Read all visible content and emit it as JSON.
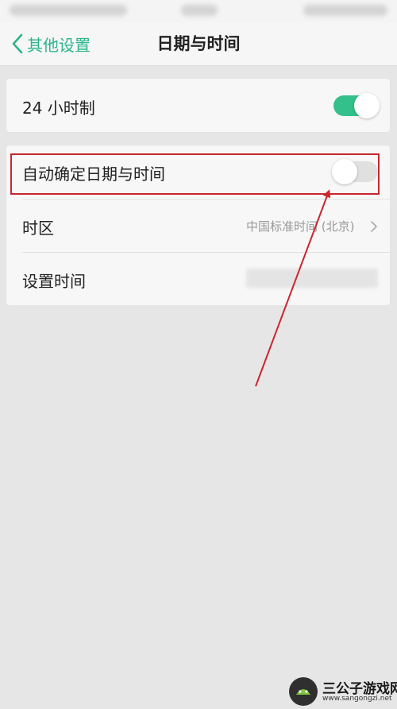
{
  "nav": {
    "back_label": "其他设置",
    "title": "日期与时间"
  },
  "settings": {
    "hour24": {
      "label": "24 小时制",
      "enabled": true
    },
    "auto_datetime": {
      "label": "自动确定日期与时间",
      "enabled": false
    },
    "timezone": {
      "label": "时区",
      "value": "中国标准时间 (北京)"
    },
    "set_time": {
      "label": "设置时间"
    }
  },
  "watermark": {
    "title": "三公子游戏网",
    "url": "www.sangongzi.net"
  },
  "colors": {
    "accent": "#2bb589",
    "toggle_on": "#34c08a",
    "annotation_red": "#c9262d"
  }
}
